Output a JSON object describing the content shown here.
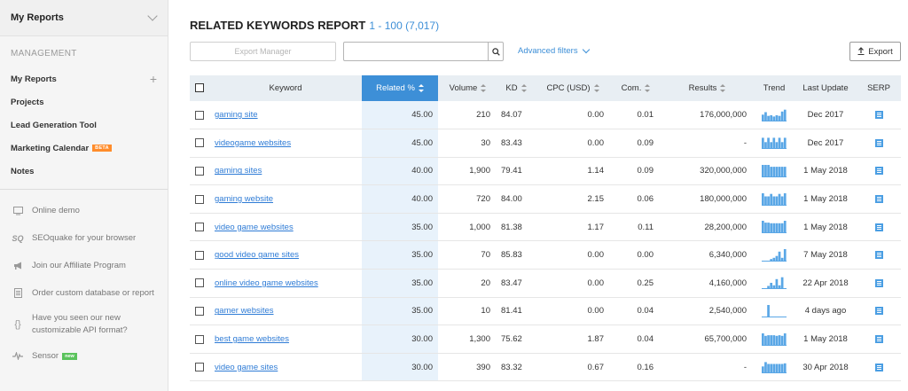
{
  "sidebar": {
    "header": "My Reports",
    "section_heading": "MANAGEMENT",
    "items": [
      {
        "label": "My Reports",
        "has_plus": true
      },
      {
        "label": "Projects"
      },
      {
        "label": "Lead Generation Tool"
      },
      {
        "label": "Marketing Calendar",
        "badge": "BETA"
      },
      {
        "label": "Notes"
      }
    ],
    "links": [
      {
        "label": "Online demo",
        "icon": "monitor-icon"
      },
      {
        "label": "SEOquake for your browser",
        "icon": "seoquake-icon"
      },
      {
        "label": "Join our Affiliate Program",
        "icon": "megaphone-icon"
      },
      {
        "label": "Order custom database or report",
        "icon": "document-icon"
      },
      {
        "label_line1": "Have you seen our new",
        "label_line2": "customizable API format?",
        "icon": "braces-icon"
      },
      {
        "label": "Sensor",
        "badge": "new",
        "icon": "pulse-icon"
      }
    ]
  },
  "report": {
    "title": "RELATED KEYWORDS REPORT",
    "range": "1 - 100 (7,017)"
  },
  "toolbar": {
    "export_manager": "Export Manager",
    "search_placeholder": "",
    "advanced_filters": "Advanced filters",
    "export": "Export"
  },
  "colors": {
    "accent": "#3d8fd7",
    "trend": "#5aa7e6",
    "beta": "#ff8c2b",
    "new": "#5ac35c"
  },
  "table": {
    "columns": [
      "Keyword",
      "Related %",
      "Volume",
      "KD",
      "CPC (USD)",
      "Com.",
      "Results",
      "Trend",
      "Last Update",
      "SERP"
    ],
    "rows": [
      {
        "keyword": "gaming site",
        "related": "45.00",
        "volume": "210",
        "kd": "84.07",
        "cpc": "0.00",
        "com": "0.01",
        "results": "176,000,000",
        "last_update": "Dec 2017",
        "trend": [
          0.55,
          0.75,
          0.45,
          0.5,
          0.4,
          0.5,
          0.45,
          0.8,
          0.95
        ]
      },
      {
        "keyword": "videogame websites",
        "related": "45.00",
        "volume": "30",
        "kd": "83.43",
        "cpc": "0.00",
        "com": "0.09",
        "results": "-",
        "last_update": "Dec 2017",
        "trend": [
          0.9,
          0.55,
          0.9,
          0.55,
          0.9,
          0.55,
          0.9,
          0.55,
          0.9
        ]
      },
      {
        "keyword": "gaming sites",
        "related": "40.00",
        "volume": "1,900",
        "kd": "79.41",
        "cpc": "1.14",
        "com": "0.09",
        "results": "320,000,000",
        "last_update": "1 May 2018",
        "trend": [
          1,
          1,
          1,
          0.85,
          0.85,
          0.85,
          0.85,
          0.85,
          0.85
        ]
      },
      {
        "keyword": "gaming website",
        "related": "40.00",
        "volume": "720",
        "kd": "84.00",
        "cpc": "2.15",
        "com": "0.06",
        "results": "180,000,000",
        "last_update": "1 May 2018",
        "trend": [
          1,
          0.75,
          0.75,
          0.95,
          0.75,
          0.75,
          0.95,
          0.75,
          1
        ]
      },
      {
        "keyword": "video game websites",
        "related": "35.00",
        "volume": "1,000",
        "kd": "81.38",
        "cpc": "1.17",
        "com": "0.11",
        "results": "28,200,000",
        "last_update": "1 May 2018",
        "trend": [
          1,
          0.85,
          0.85,
          0.8,
          0.8,
          0.8,
          0.8,
          0.8,
          1
        ]
      },
      {
        "keyword": "good video game sites",
        "related": "35.00",
        "volume": "70",
        "kd": "85.83",
        "cpc": "0.00",
        "com": "0.00",
        "results": "6,340,000",
        "last_update": "7 May 2018",
        "trend": [
          0.05,
          0.05,
          0.05,
          0.2,
          0.3,
          0.45,
          0.8,
          0.3,
          1
        ]
      },
      {
        "keyword": "online video game websites",
        "related": "35.00",
        "volume": "20",
        "kd": "83.47",
        "cpc": "0.00",
        "com": "0.25",
        "results": "4,160,000",
        "last_update": "22 Apr 2018",
        "trend": [
          0.05,
          0.05,
          0.25,
          0.5,
          0.3,
          0.8,
          0.3,
          0.95,
          0.05
        ]
      },
      {
        "keyword": "gamer websites",
        "related": "35.00",
        "volume": "10",
        "kd": "81.41",
        "cpc": "0.00",
        "com": "0.04",
        "results": "2,540,000",
        "last_update": "4 days ago",
        "trend": [
          0.05,
          0.05,
          1,
          0.05,
          0.05,
          0.05,
          0.05,
          0.05,
          0.05
        ]
      },
      {
        "keyword": "best game websites",
        "related": "30.00",
        "volume": "1,300",
        "kd": "75.62",
        "cpc": "1.87",
        "com": "0.04",
        "results": "65,700,000",
        "last_update": "1 May 2018",
        "trend": [
          1,
          0.8,
          0.85,
          0.85,
          0.85,
          0.8,
          0.85,
          0.8,
          1
        ]
      },
      {
        "keyword": "video game sites",
        "related": "30.00",
        "volume": "390",
        "kd": "83.32",
        "cpc": "0.67",
        "com": "0.16",
        "results": "-",
        "last_update": "30 Apr 2018",
        "trend": [
          0.55,
          0.9,
          0.75,
          0.75,
          0.75,
          0.75,
          0.75,
          0.75,
          0.8
        ]
      }
    ]
  }
}
